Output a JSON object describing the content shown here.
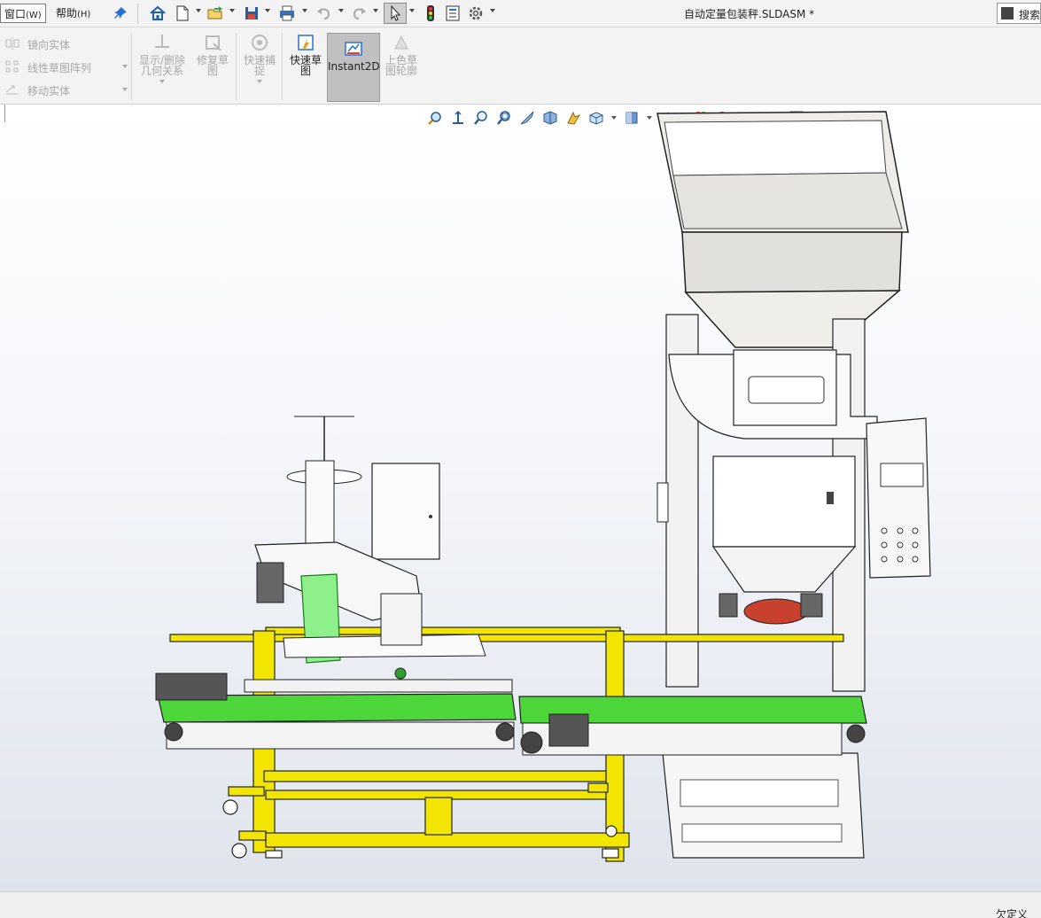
{
  "menubar": {
    "window_menu": "窗口",
    "window_menu_key": "(W)",
    "help_menu": "帮助",
    "help_menu_key": "(H)",
    "document_title": "自动定量包装秤.SLDASM *",
    "search_label": "搜索"
  },
  "quick_access": {
    "icons": [
      "home-icon",
      "new-document-icon",
      "open-icon",
      "save-icon",
      "print-icon",
      "undo-icon",
      "redo-icon",
      "select-cursor-icon",
      "rebuild-traffic-light-icon",
      "file-properties-icon",
      "options-gear-icon"
    ]
  },
  "ribbon": {
    "col1": [
      {
        "label": "镜向实体"
      },
      {
        "label": "线性草图阵列"
      },
      {
        "label": "移动实体"
      }
    ],
    "show_delete_relations": "显示/删除\n几何关系",
    "repair_sketch": "修复草\n图",
    "quick_snaps": "快速捕\n捉",
    "rapid_sketch": "快速草\n图",
    "instant2d": "Instant2D",
    "shaded_sketch_contours": "上色草\n图轮廓"
  },
  "heads_up_toolbar": {
    "icons": [
      "zoom-to-fit-icon",
      "zoom-to-area-icon",
      "previous-view-icon",
      "section-view-icon",
      "dynamic-annotation-icon",
      "view-orientation-icon",
      "display-style-icon",
      "hide-show-items-icon",
      "edit-appearance-icon",
      "apply-scene-icon",
      "view-settings-icon",
      "monitor-icon",
      "split-view-icon"
    ]
  },
  "colors": {
    "frame_yellow": "#f2e600",
    "belt_green": "#4cd63a",
    "guide_green": "#8ef08a",
    "hopper_grey": "#eceae6",
    "discharge_red": "#c8402e",
    "accent_blue": "#2a6fd6"
  },
  "status": {
    "right_text": "欠定义"
  }
}
